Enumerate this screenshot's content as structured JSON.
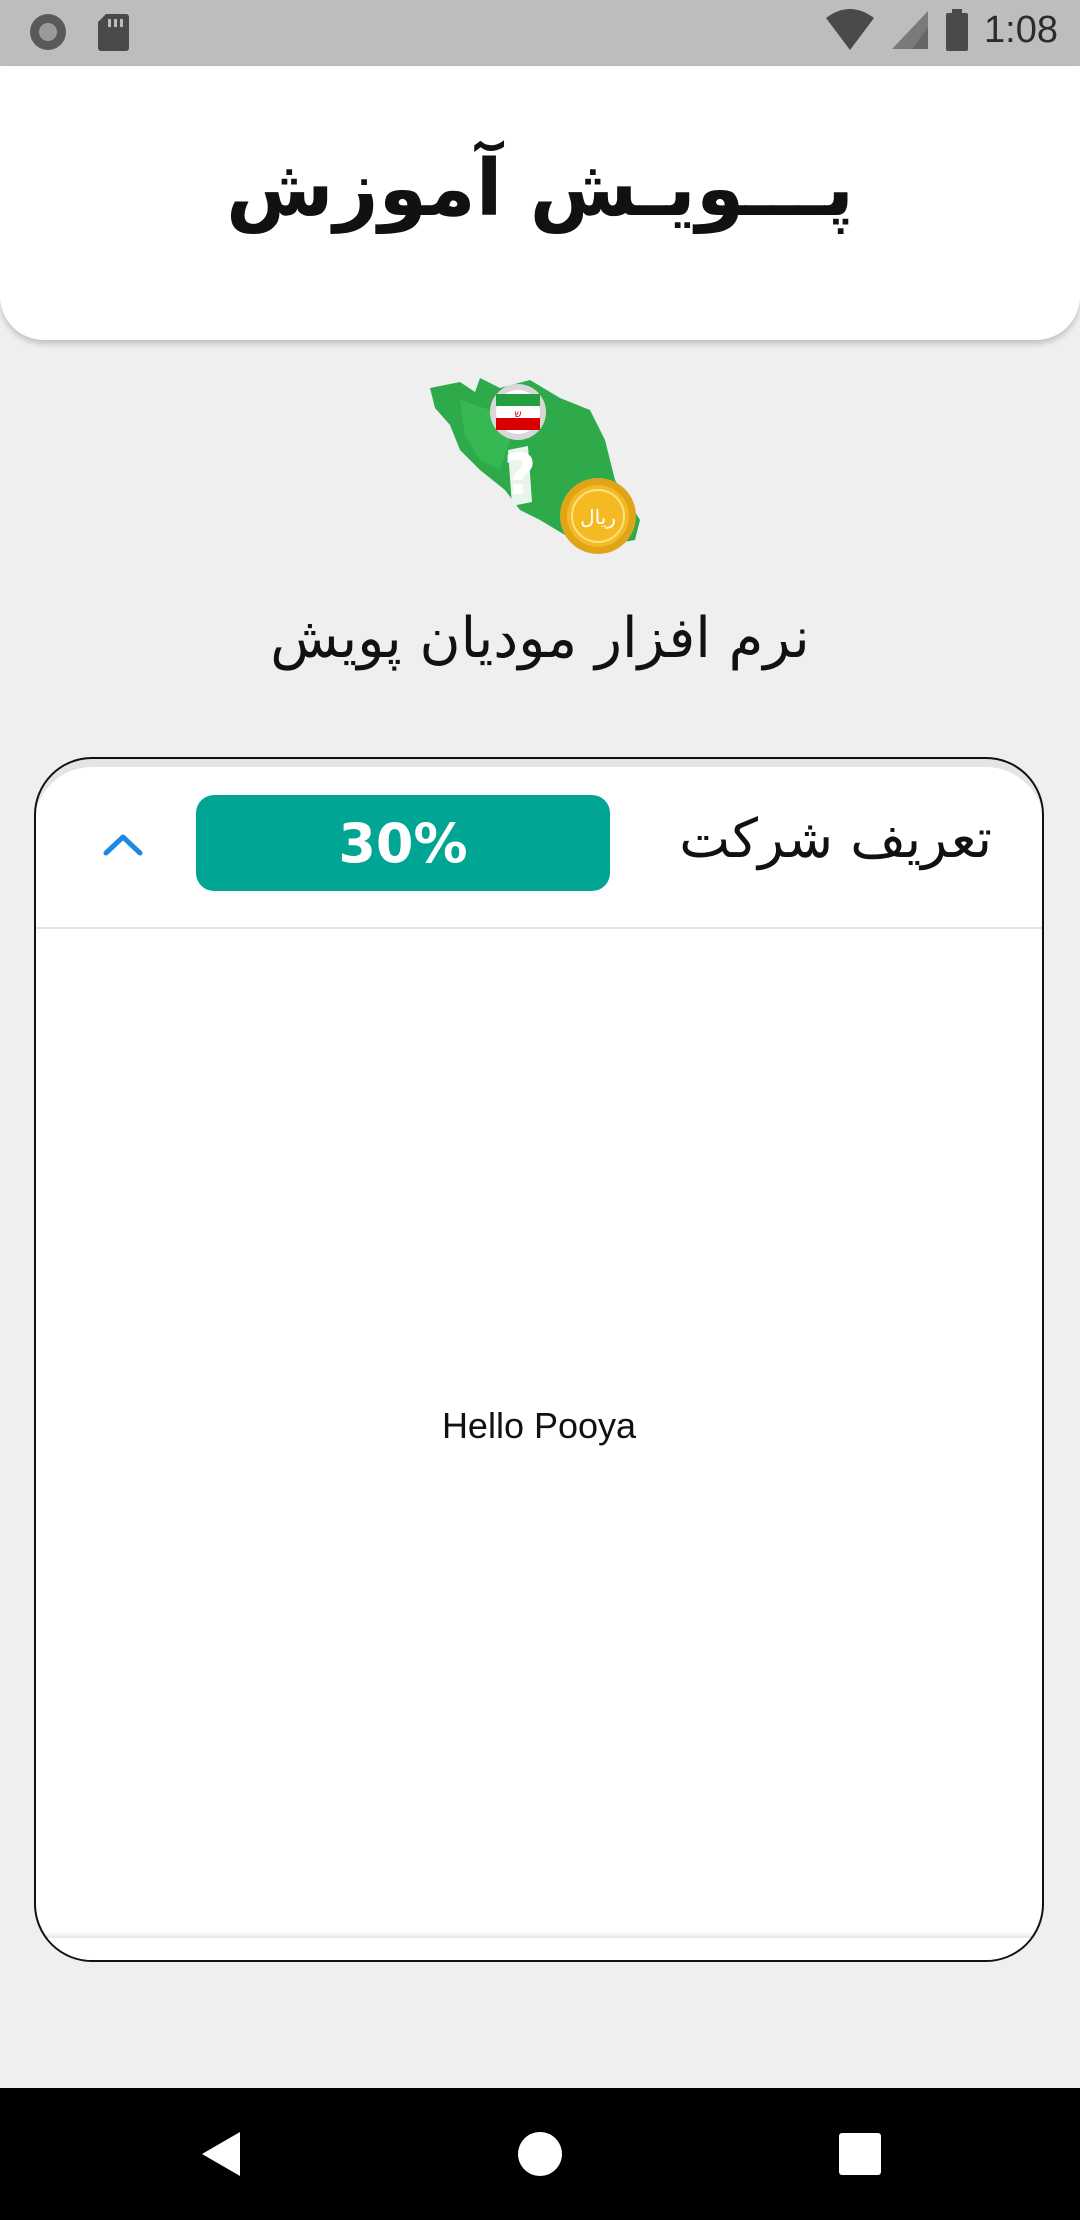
{
  "status_bar": {
    "time": "1:08",
    "icons": [
      "record-icon",
      "sd-card-icon",
      "wifi-icon",
      "signal-icon",
      "battery-icon"
    ]
  },
  "header": {
    "title": "پـــویـش آموزش"
  },
  "logo": {
    "icon": "iran-map-logo",
    "coin_text": "ریال"
  },
  "subtitle": "نرم افزار مودیان پویش",
  "card": {
    "title": "تعریف شرکت",
    "progress_label": "30%",
    "progress": 0.3,
    "expand_icon": "chevron-up-icon",
    "body_text": "Hello Pooya"
  },
  "colors": {
    "accent": "#00a693",
    "chevron": "#1e88e5",
    "logo_green": "#2eaa4a",
    "coin_gold": "#f5b921"
  },
  "nav_bar": {
    "icons": [
      "back-icon",
      "home-icon",
      "recents-icon"
    ]
  }
}
